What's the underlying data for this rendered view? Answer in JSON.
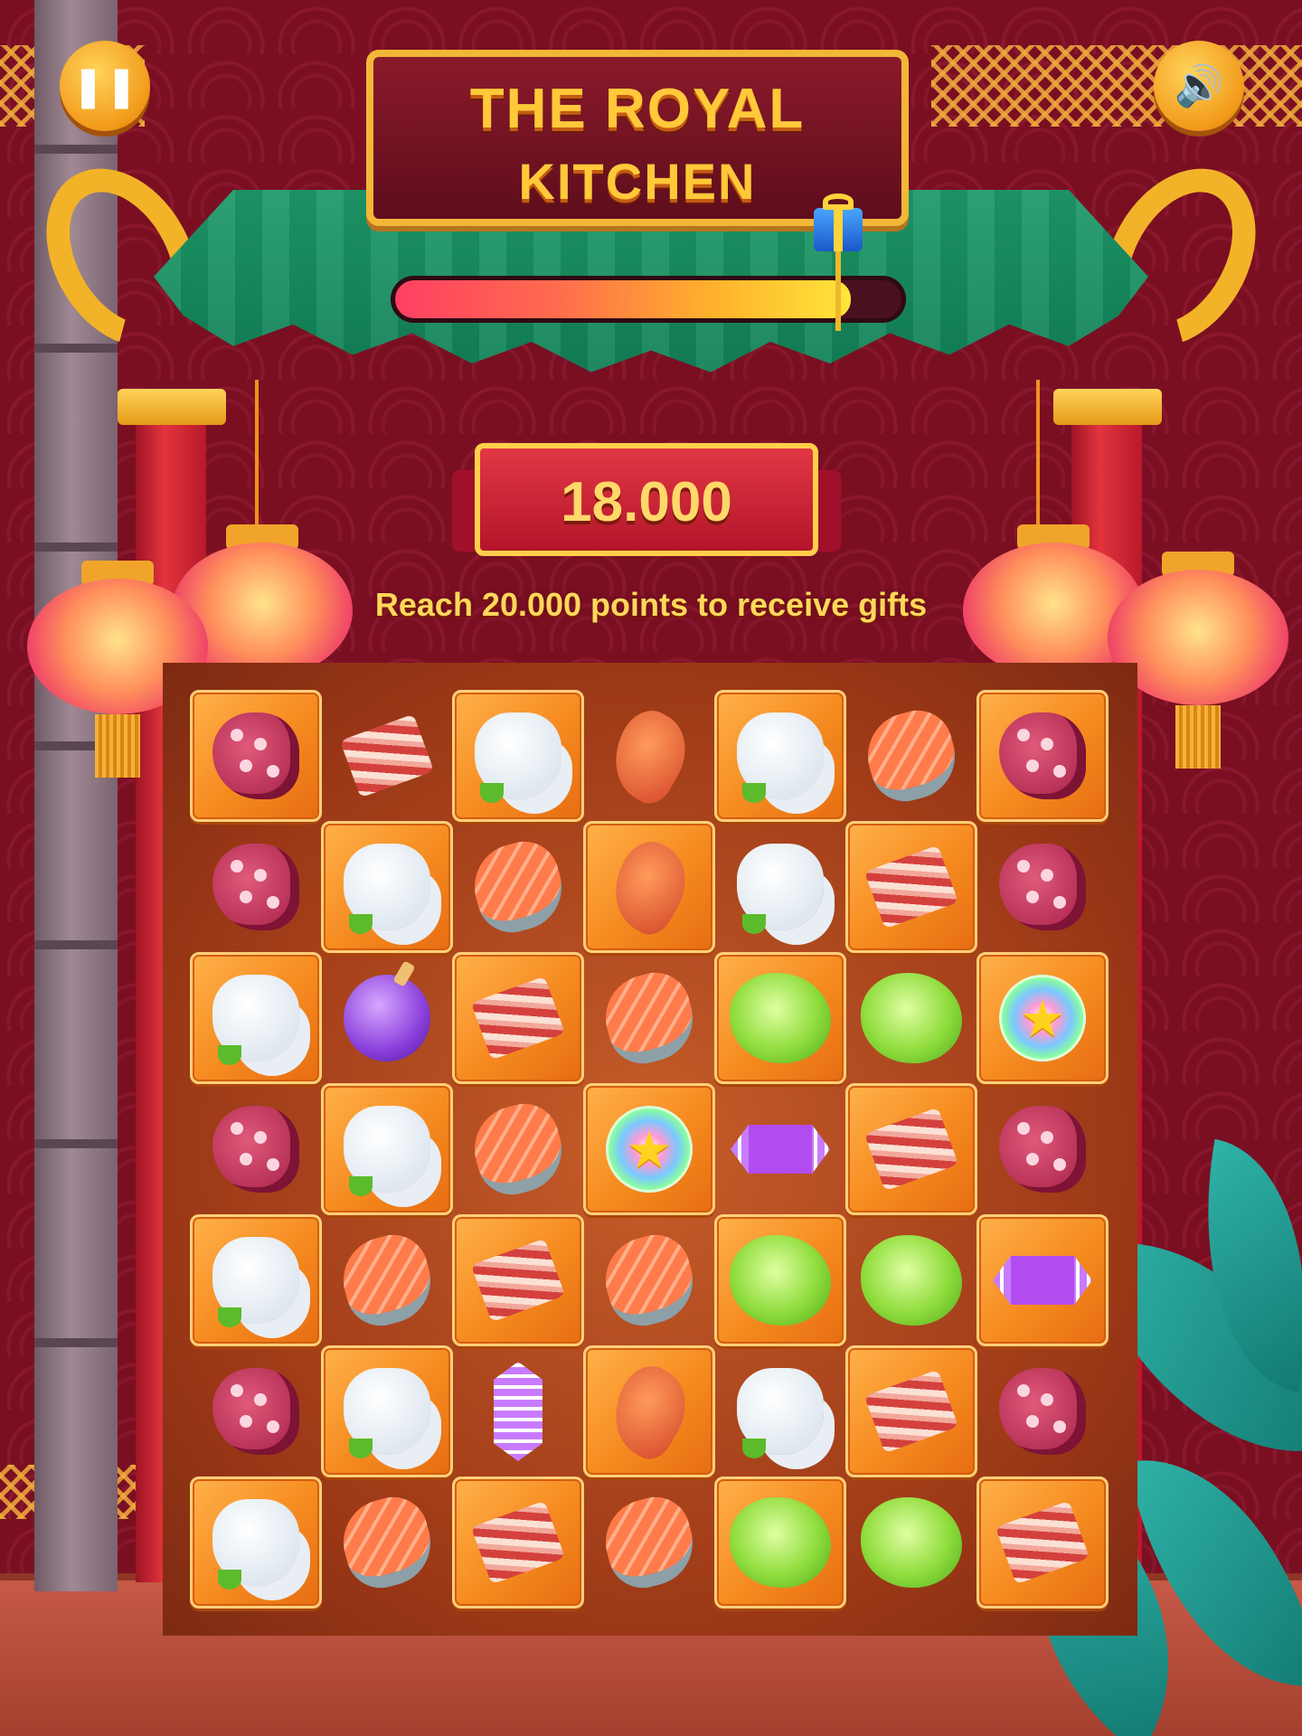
{
  "header": {
    "title_line1": "THE ROYAL",
    "title_line2": "KITCHEN"
  },
  "controls": {
    "pause_icon": "pause-icon",
    "sound_icon": "speaker-icon"
  },
  "progress": {
    "fraction": 0.9,
    "reward_icon": "gift-box-icon"
  },
  "score": {
    "value": "18.000"
  },
  "goal": {
    "text": "Reach 20.000 points to receive gifts"
  },
  "board": {
    "rows": 7,
    "cols": 7,
    "grid": [
      [
        "octopus",
        "bacon",
        "radish",
        "crab",
        "radish",
        "salmon",
        "octopus"
      ],
      [
        "octopus",
        "radish",
        "salmon",
        "crab",
        "radish",
        "bacon",
        "octopus"
      ],
      [
        "radish",
        "bomb",
        "bacon",
        "salmon",
        "lettuce",
        "lettuce",
        "rainbow-star"
      ],
      [
        "octopus",
        "radish",
        "salmon",
        "rainbow-star",
        "striped-candy-horizontal",
        "bacon",
        "octopus"
      ],
      [
        "radish",
        "salmon",
        "bacon",
        "salmon",
        "lettuce",
        "lettuce",
        "striped-candy-horizontal"
      ],
      [
        "octopus",
        "radish",
        "striped-candy-vertical",
        "crab",
        "radish",
        "bacon",
        "octopus"
      ],
      [
        "radish",
        "salmon",
        "bacon",
        "salmon",
        "lettuce",
        "lettuce",
        "bacon"
      ]
    ]
  },
  "colors": {
    "background": "#7a0f22",
    "tile": "#f58a1f",
    "board": "#9b3816",
    "accent": "#ffc93a"
  }
}
